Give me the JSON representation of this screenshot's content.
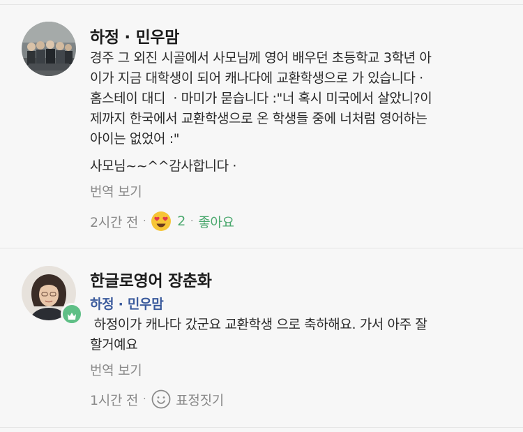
{
  "comment1": {
    "author": "하정 · 민우맘",
    "text_lines": [
      "경주 그 외진 시골에서 사모님께 영어 배우던 초등학교 3학년 아",
      "이가 지금 대학생이 되어 캐나다에 교환학생으로 가 있습니다 ·",
      "홈스테이 대디  · 마미가 묻습니다 :\"너 혹시 미국에서 살았니?이",
      "제까지 한국에서 교환학생으로 온 학생들 중에 너처럼 영어하는",
      "아이는 없었어 :\"",
      "사모님~~^^감사합니다 ·"
    ],
    "translate_label": "번역 보기",
    "time": "2시간 전",
    "separator": "·",
    "reaction_icon": "heart-eyes-emoji-icon",
    "reaction_count": "2",
    "like_label": "좋아요"
  },
  "comment2": {
    "author": "한글로영어 장춘화",
    "mention": "하정 · 민우맘",
    "text_lines": [
      " 하정이가 캐나다 갔군요 교환학생 으로 축하해요. 가서 아주 잘",
      "할거예요"
    ],
    "translate_label": "번역 보기",
    "time": "1시간 전",
    "separator": "·",
    "react_icon": "smiley-outline-icon",
    "react_label": "표정짓기",
    "badge_icon": "crown-icon"
  },
  "colors": {
    "accent_green": "#4ba86e",
    "mention_blue": "#3a5a9c",
    "badge_green": "#5fbf86"
  }
}
